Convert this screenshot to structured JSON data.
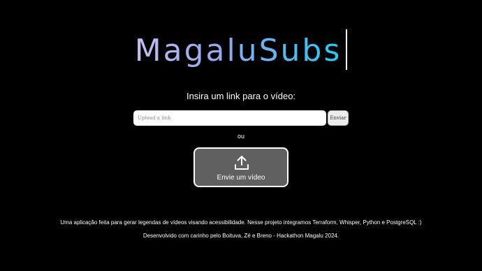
{
  "header": {
    "title": "MagaluSubs"
  },
  "form": {
    "prompt": "Insira um link para o vídeo:",
    "link_placeholder": "Upload a link",
    "send_label": "Enviar",
    "or_label": "ou",
    "upload_label": "Envie um vídeo",
    "upload_icon": "upload-icon"
  },
  "footer": {
    "description": "Uma aplicação feita para gerar legendas de vídeos visando acessibilidade. Nesse projeto integramos Terraform, Whisper, Python e PostgreSQL :)",
    "credits": "Desenvolvido com carinho pelo Boituva, Zé e Breno - Hackathon Magalu 2024."
  },
  "colors": {
    "background": "#000000",
    "title_gradient_start": "#c7bff0",
    "title_gradient_end": "#1ad0f3",
    "upload_button_bg": "#606060"
  }
}
